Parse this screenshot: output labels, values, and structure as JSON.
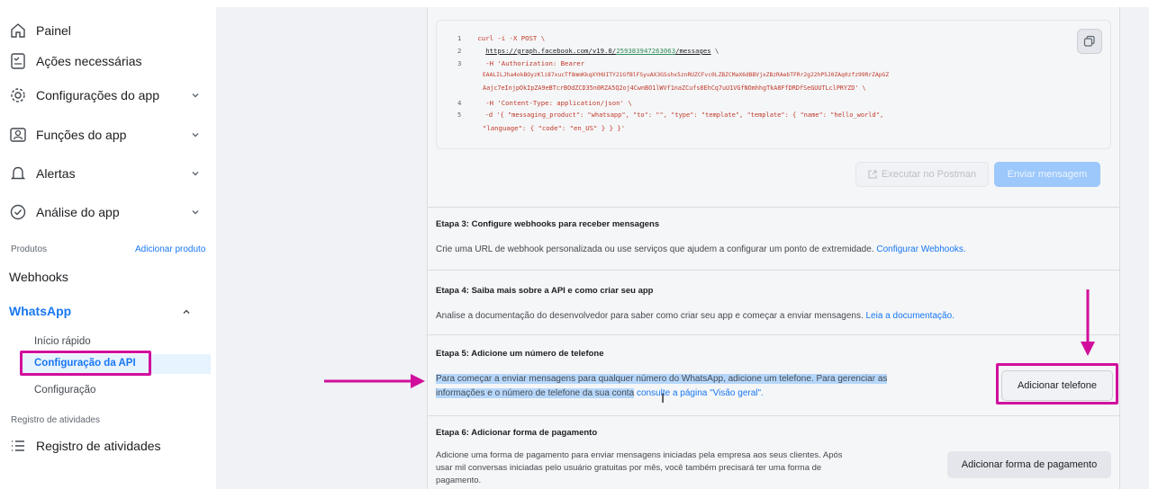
{
  "sidebar": {
    "items": [
      {
        "label": "Painel",
        "icon": "home-icon"
      },
      {
        "label": "Ações necessárias",
        "icon": "checklist-icon"
      },
      {
        "label": "Configurações do app",
        "icon": "gear-icon"
      },
      {
        "label": "Funções do app",
        "icon": "roles-icon"
      },
      {
        "label": "Alertas",
        "icon": "bell-icon"
      },
      {
        "label": "Análise do app",
        "icon": "check-circle-icon"
      }
    ],
    "products_label": "Produtos",
    "add_product": "Adicionar produto",
    "webhooks": "Webhooks",
    "whatsapp": "WhatsApp",
    "whatsapp_sub": [
      "Início rápido",
      "Configuração da API",
      "Configuração"
    ],
    "activity_label": "Registro de atividades",
    "activity_item": "Registro de atividades"
  },
  "code": {
    "lines": [
      {
        "n": "1",
        "text": "curl -i -X POST \\"
      },
      {
        "n": "2",
        "pre": "  ",
        "url_a": "https://graph.facebook.com/v19.0/",
        "url_b": "259383947263063",
        "url_c": "/messages",
        "post": " \\"
      },
      {
        "n": "3",
        "text": "  -H 'Authorization: Bearer"
      },
      {
        "n": "",
        "text": "EAALILJha4okBOyzKli87xucTf8mmKkqXYHUITY21GfBlFSyuAX3GSshx5znRUZCFvc0LZBZCMaX6dBBVjxZBzRAebTFRr2g22hP5J0ZAq0zfz99RrZApGZ"
      },
      {
        "n": "",
        "text": "Aajc7eInjpOkIpZA9eBTcrBOdZCD35n0RZA5Q2oj4CwnBO1lWVf1naZCufs8EhCq7uU1VGfNOmhhgTkA8FfDRDfSeGUUTLclPRYZD' \\"
      },
      {
        "n": "4",
        "text": "  -H 'Content-Type: application/json' \\"
      },
      {
        "n": "5",
        "text": "  -d '{ \"messaging_product\": \"whatsapp\", \"to\": \"\", \"type\": \"template\", \"template\": { \"name\": \"hello_world\","
      },
      {
        "n": "",
        "text": "\"language\": { \"code\": \"en_US\" } } }'"
      }
    ],
    "postman_button": "Executar no Postman",
    "send_button": "Enviar mensagem"
  },
  "steps": {
    "step3": {
      "title": "Etapa 3: Configure webhooks para receber mensagens",
      "text": "Crie uma URL de webhook personalizada ou use serviços que ajudem a configurar um ponto de extremidade. ",
      "link": "Configurar Webhooks."
    },
    "step4": {
      "title": "Etapa 4: Saiba mais sobre a API e como criar seu app",
      "text": "Analise a documentação do desenvolvedor para saber como criar seu app e começar a enviar mensagens. ",
      "link": "Leia a documentação."
    },
    "step5": {
      "title": "Etapa 5: Adicione um número de telefone",
      "line1": "Para começar a enviar mensagens para qualquer número do WhatsApp, adicione um telefone. Para gerenciar as",
      "line2_sel": "informações e o número de telefone da sua conta",
      "line2_link": "consulte a página \"Visão geral\".",
      "button": "Adicionar telefone"
    },
    "step6": {
      "title": "Etapa 6: Adicionar forma de pagamento",
      "line1": "Adicione uma forma de pagamento para enviar mensagens iniciadas pela empresa aos seus clientes. Após",
      "line2": "usar mil conversas iniciadas pelo usuário gratuitas por mês, você também precisará ter uma forma de",
      "line3": "pagamento.",
      "button": "Adicionar forma de pagamento"
    }
  },
  "colors": {
    "highlight": "#d10f9c",
    "link": "#1877f2"
  }
}
